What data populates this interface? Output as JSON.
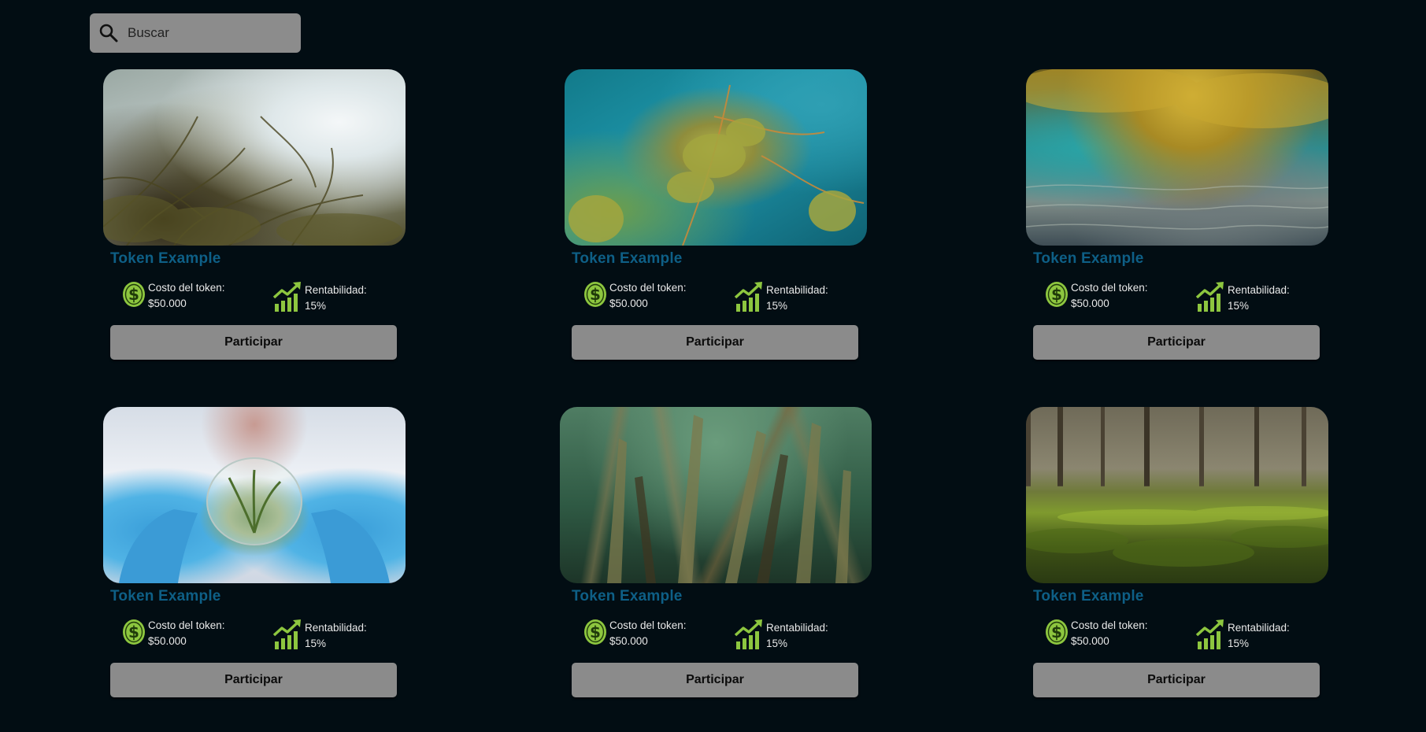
{
  "search": {
    "placeholder": "Buscar",
    "icon": "search-icon"
  },
  "colors": {
    "background": "#020d13",
    "title": "#0e5f86",
    "button": "#8b8b8b",
    "icon_green": "#8dc63f"
  },
  "cards": [
    {
      "title": "Token Example",
      "cost_label": "Costo del token:",
      "cost_value": "$50.000",
      "profit_label": "Rentabilidad:",
      "profit_value": "15%",
      "button_label": "Participar",
      "image": "underwater-algae-light"
    },
    {
      "title": "Token Example",
      "cost_label": "Costo del token:",
      "cost_value": "$50.000",
      "profit_label": "Rentabilidad:",
      "profit_value": "15%",
      "button_label": "Participar",
      "image": "underwater-green-plant"
    },
    {
      "title": "Token Example",
      "cost_label": "Costo del token:",
      "cost_value": "$50.000",
      "profit_label": "Rentabilidad:",
      "profit_value": "15%",
      "button_label": "Participar",
      "image": "underwater-surface-algae"
    },
    {
      "title": "Token Example",
      "cost_label": "Costo del token:",
      "cost_value": "$50.000",
      "profit_label": "Rentabilidad:",
      "profit_value": "15%",
      "button_label": "Participar",
      "image": "scientist-petri-dish-algae"
    },
    {
      "title": "Token Example",
      "cost_label": "Costo del token:",
      "cost_value": "$50.000",
      "profit_label": "Rentabilidad:",
      "profit_value": "15%",
      "button_label": "Participar",
      "image": "seagrass-underwater"
    },
    {
      "title": "Token Example",
      "cost_label": "Costo del token:",
      "cost_value": "$50.000",
      "profit_label": "Rentabilidad:",
      "profit_value": "15%",
      "button_label": "Participar",
      "image": "swamp-green-algae"
    }
  ]
}
